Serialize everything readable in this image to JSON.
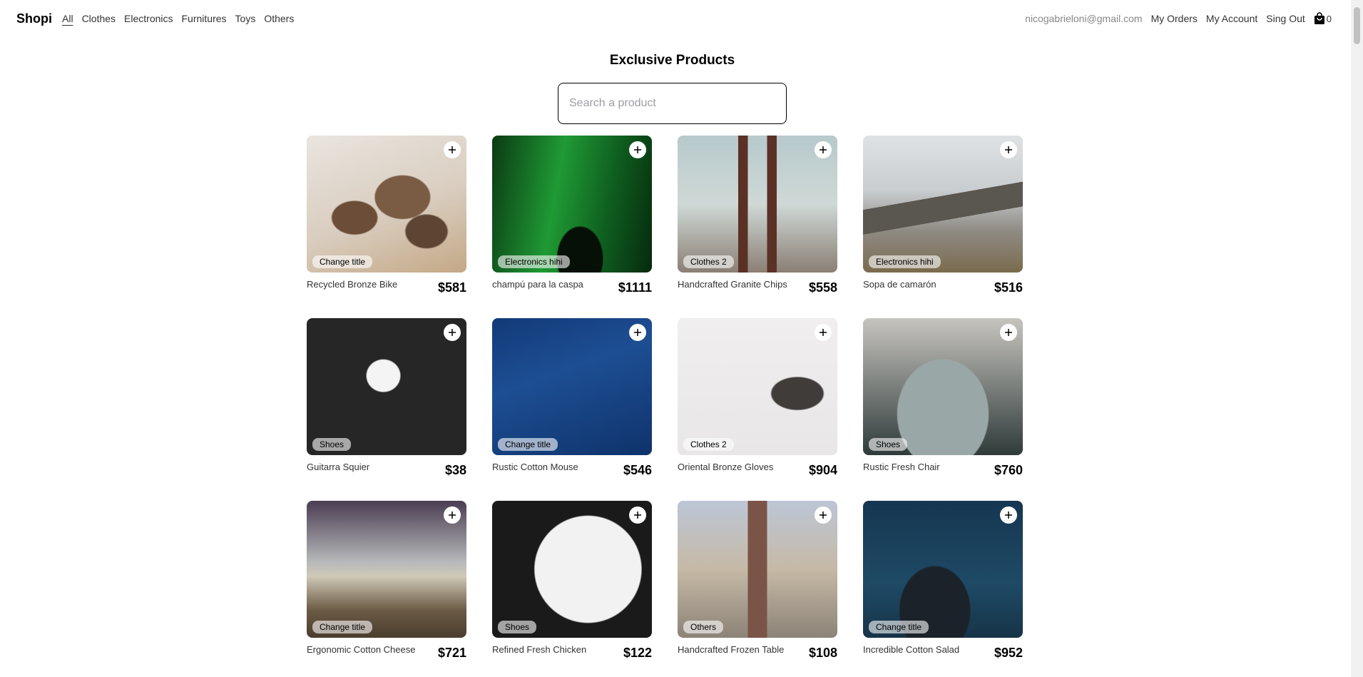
{
  "nav": {
    "brand": "Shopi",
    "categories": [
      "All",
      "Clothes",
      "Electronics",
      "Furnitures",
      "Toys",
      "Others"
    ],
    "active_category": "All",
    "email": "nicogabrieloni@gmail.com",
    "my_orders": "My Orders",
    "my_account": "My Account",
    "sign_out": "Sing Out",
    "cart_count": "0"
  },
  "page": {
    "title": "Exclusive Products",
    "search_placeholder": "Search a product"
  },
  "products": [
    {
      "name": "Recycled Bronze Bike",
      "price": "$581",
      "category": "Change title",
      "image": "coffee-beans"
    },
    {
      "name": "champú para la caspa",
      "price": "$1111",
      "category": "Electronics hihi",
      "image": "aurora-tree"
    },
    {
      "name": "Handcrafted Granite Chips",
      "price": "$558",
      "category": "Clothes 2",
      "image": "brooklyn-bridge"
    },
    {
      "name": "Sopa de camarón",
      "price": "$516",
      "category": "Electronics hihi",
      "image": "snowy-mountain"
    },
    {
      "name": "Guitarra Squier",
      "price": "$38",
      "category": "Shoes",
      "image": "tunnel-silhouettes"
    },
    {
      "name": "Rustic Cotton Mouse",
      "price": "$546",
      "category": "Change title",
      "image": "ocean-water"
    },
    {
      "name": "Oriental Bronze Gloves",
      "price": "$904",
      "category": "Clothes 2",
      "image": "misty-peak"
    },
    {
      "name": "Rustic Fresh Chair",
      "price": "$760",
      "category": "Shoes",
      "image": "vintage-car"
    },
    {
      "name": "Ergonomic Cotton Cheese",
      "price": "$721",
      "category": "Change title",
      "image": "cliff-sunset"
    },
    {
      "name": "Refined Fresh Chicken",
      "price": "$122",
      "category": "Shoes",
      "image": "clock-face"
    },
    {
      "name": "Handcrafted Frozen Table",
      "price": "$108",
      "category": "Others",
      "image": "railway-track"
    },
    {
      "name": "Incredible Cotton Salad",
      "price": "$952",
      "category": "Change title",
      "image": "underwater-person"
    }
  ],
  "icons": {
    "add": "plus-icon",
    "cart": "shopping-bag-icon"
  }
}
